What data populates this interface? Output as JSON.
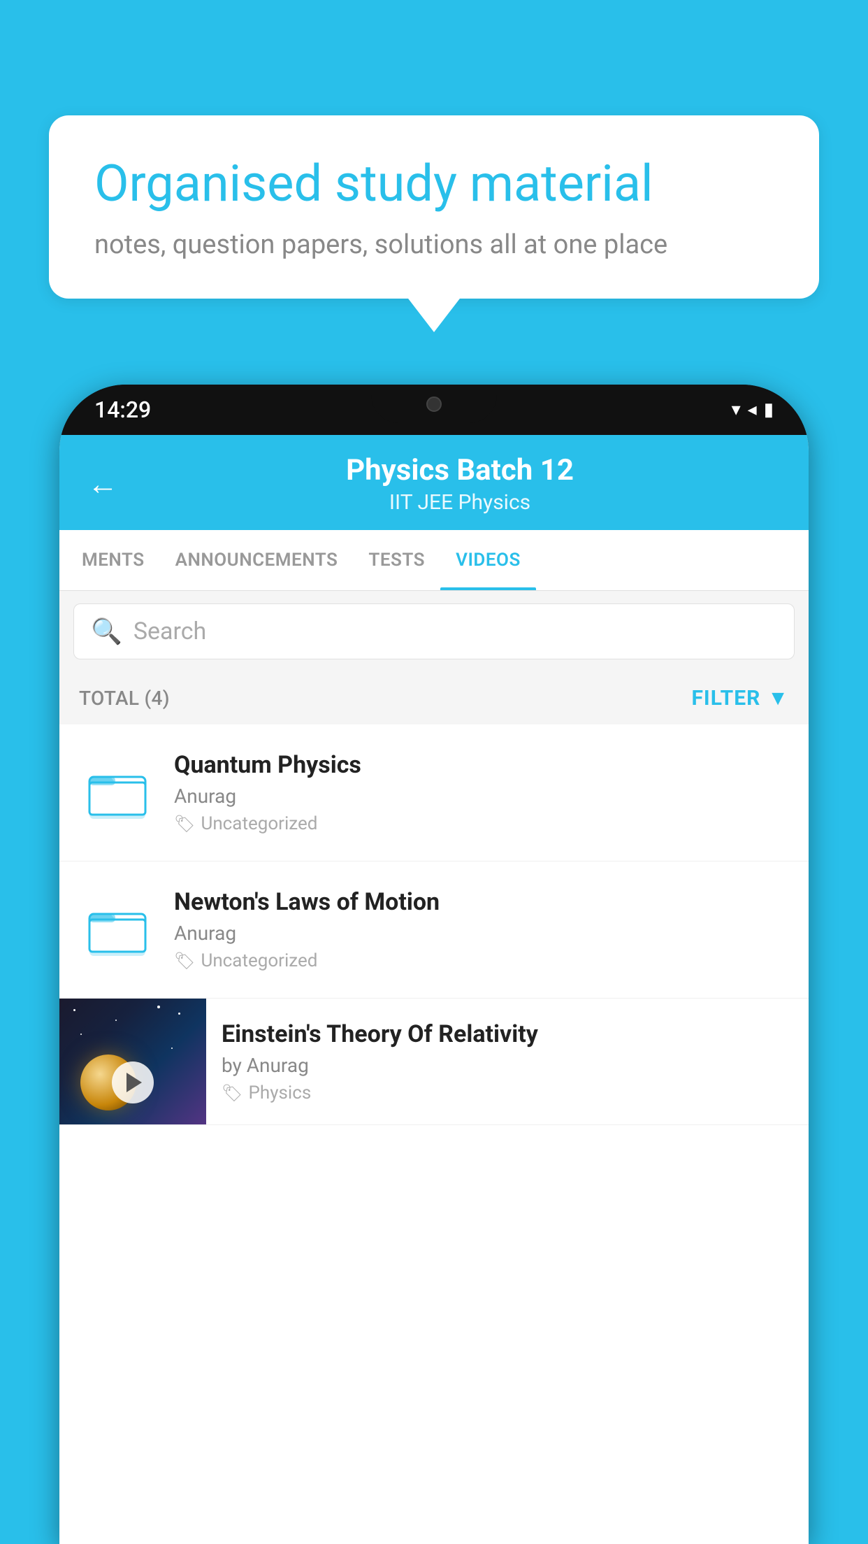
{
  "background": {
    "color": "#29BFEA"
  },
  "bubble": {
    "title": "Organised study material",
    "subtitle": "notes, question papers, solutions all at one place"
  },
  "phone": {
    "time": "14:29",
    "header": {
      "back_label": "←",
      "title": "Physics Batch 12",
      "subtitle": "IIT JEE   Physics"
    },
    "tabs": [
      {
        "label": "MENTS",
        "active": false
      },
      {
        "label": "ANNOUNCEMENTS",
        "active": false
      },
      {
        "label": "TESTS",
        "active": false
      },
      {
        "label": "VIDEOS",
        "active": true
      }
    ],
    "search": {
      "placeholder": "Search"
    },
    "filter": {
      "total_label": "TOTAL (4)",
      "filter_label": "FILTER"
    },
    "videos": [
      {
        "id": "quantum",
        "title": "Quantum Physics",
        "author": "Anurag",
        "tag": "Uncategorized",
        "has_thumb": false
      },
      {
        "id": "newton",
        "title": "Newton's Laws of Motion",
        "author": "Anurag",
        "tag": "Uncategorized",
        "has_thumb": false
      },
      {
        "id": "einstein",
        "title": "Einstein's Theory Of Relativity",
        "author": "by Anurag",
        "tag": "Physics",
        "has_thumb": true
      }
    ]
  }
}
